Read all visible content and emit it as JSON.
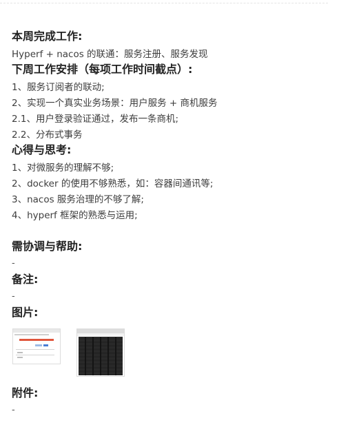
{
  "sections": {
    "done_heading": "本周完成工作:",
    "done_items": [
      "Hyperf + nacos 的联通：服务注册、服务发现"
    ],
    "plan_heading": "下周工作安排（每项工作时间截点）:",
    "plan_items": [
      "1、服务订阅者的联动;",
      "2、实现一个真实业务场景：用户服务 + 商机服务",
      "2.1、用户登录验证通过，发布一条商机;",
      "2.2、分布式事务"
    ],
    "thoughts_heading": "心得与思考:",
    "thoughts_items": [
      "1、对微服务的理解不够;",
      "2、docker 的使用不够熟悉，如：容器间通讯等;",
      "3、nacos 服务治理的不够了解;",
      "4、hyperf 框架的熟悉与运用;"
    ],
    "help_heading": "需协调与帮助:",
    "help_value": "-",
    "notes_heading": "备注:",
    "notes_value": "-",
    "images_heading": "图片:",
    "images": [
      {
        "name": "screenshot-web-page",
        "title_color": "#e0553c"
      },
      {
        "name": "screenshot-terminal",
        "bg_color": "#141414"
      }
    ],
    "attachments_heading": "附件:",
    "attachments_value": "-"
  }
}
